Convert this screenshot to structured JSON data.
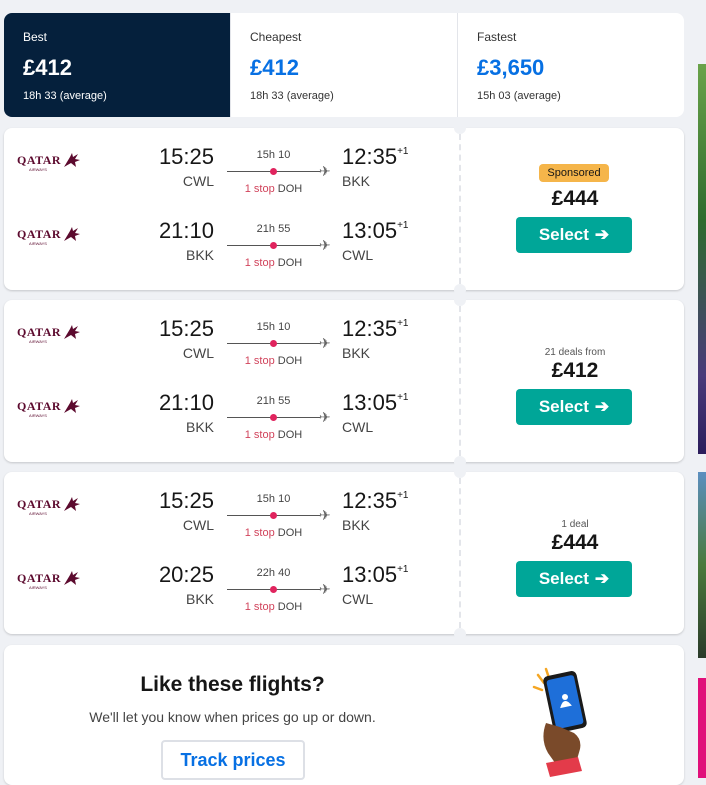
{
  "sort_tabs": [
    {
      "name": "Best",
      "price": "£412",
      "duration": "18h 33 (average)",
      "active": true
    },
    {
      "name": "Cheapest",
      "price": "£412",
      "duration": "18h 33 (average)",
      "active": false
    },
    {
      "name": "Fastest",
      "price": "£3,650",
      "duration": "15h 03 (average)",
      "active": false
    }
  ],
  "airline_logo": {
    "wordmark": "QATAR",
    "subtext": "AIRWAYS",
    "icon": "oryx-icon",
    "color": "#5c0a2e"
  },
  "results": [
    {
      "legs": [
        {
          "dep_time": "15:25",
          "dep_code": "CWL",
          "duration": "15h 10",
          "stops": "1 stop",
          "via": "DOH",
          "arr_time": "12:35",
          "day_offset": "+1",
          "arr_code": "BKK"
        },
        {
          "dep_time": "21:10",
          "dep_code": "BKK",
          "duration": "21h 55",
          "stops": "1 stop",
          "via": "DOH",
          "arr_time": "13:05",
          "day_offset": "+1",
          "arr_code": "CWL"
        }
      ],
      "badge": "Sponsored",
      "deals_note": "",
      "price": "£444",
      "select_label": "Select"
    },
    {
      "legs": [
        {
          "dep_time": "15:25",
          "dep_code": "CWL",
          "duration": "15h 10",
          "stops": "1 stop",
          "via": "DOH",
          "arr_time": "12:35",
          "day_offset": "+1",
          "arr_code": "BKK"
        },
        {
          "dep_time": "21:10",
          "dep_code": "BKK",
          "duration": "21h 55",
          "stops": "1 stop",
          "via": "DOH",
          "arr_time": "13:05",
          "day_offset": "+1",
          "arr_code": "CWL"
        }
      ],
      "badge": "",
      "deals_note": "21 deals from",
      "price": "£412",
      "select_label": "Select"
    },
    {
      "legs": [
        {
          "dep_time": "15:25",
          "dep_code": "CWL",
          "duration": "15h 10",
          "stops": "1 stop",
          "via": "DOH",
          "arr_time": "12:35",
          "day_offset": "+1",
          "arr_code": "BKK"
        },
        {
          "dep_time": "20:25",
          "dep_code": "BKK",
          "duration": "22h 40",
          "stops": "1 stop",
          "via": "DOH",
          "arr_time": "13:05",
          "day_offset": "+1",
          "arr_code": "CWL"
        }
      ],
      "badge": "",
      "deals_note": "1 deal",
      "price": "£444",
      "select_label": "Select"
    }
  ],
  "price_alert": {
    "title": "Like these flights?",
    "subtitle": "We'll let you know when prices go up or down.",
    "button_label": "Track prices",
    "illustration": "phone-alert-illustration"
  },
  "colors": {
    "active_tab_bg": "#05203c",
    "price_blue": "#0770e3",
    "select_green": "#00a698",
    "sponsored_badge": "#f5b54a",
    "stop_red": "#d1435b"
  }
}
